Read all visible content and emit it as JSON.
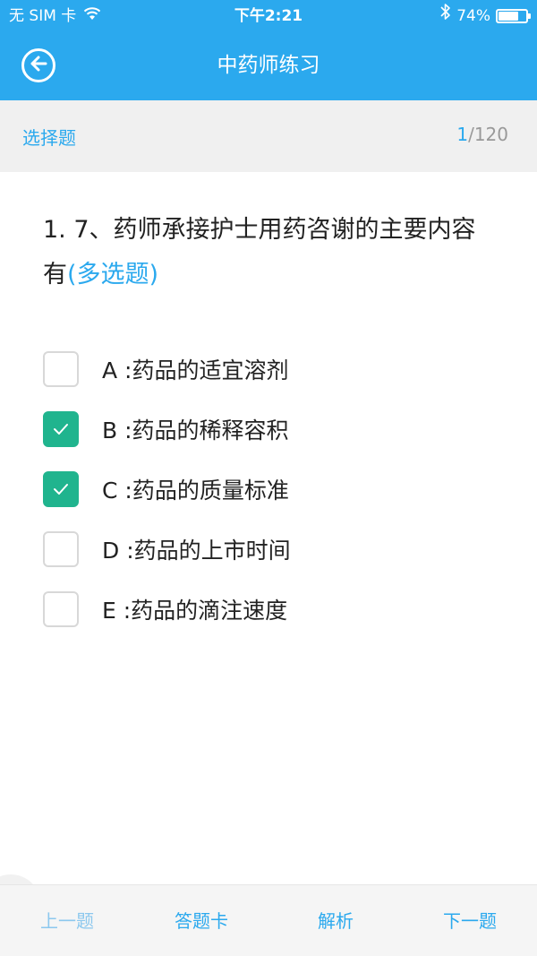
{
  "status_bar": {
    "carrier": "无 SIM 卡",
    "time": "下午2:21",
    "battery": "74%",
    "battery_level": 0.74
  },
  "nav": {
    "title": "中药师练习",
    "back_icon": "back-arrow-circle-icon"
  },
  "subheader": {
    "type": "选择题",
    "current": "1",
    "total": "/120"
  },
  "question": {
    "text": "1. 7、药师承接护士用药咨谢的主要内容有",
    "tag": "(多选题)"
  },
  "options": [
    {
      "label": "A :药品的适宜溶剂",
      "checked": false
    },
    {
      "label": "B :药品的稀释容积",
      "checked": true
    },
    {
      "label": "C :药品的质量标准",
      "checked": true
    },
    {
      "label": "D :药品的上市时间",
      "checked": false
    },
    {
      "label": "E :药品的滴注速度",
      "checked": false
    }
  ],
  "footer": {
    "prev": "上一题",
    "card": "答题卡",
    "explain": "解析",
    "next": "下一题"
  },
  "colors": {
    "primary": "#2ba9ee",
    "check": "#20b48e"
  }
}
